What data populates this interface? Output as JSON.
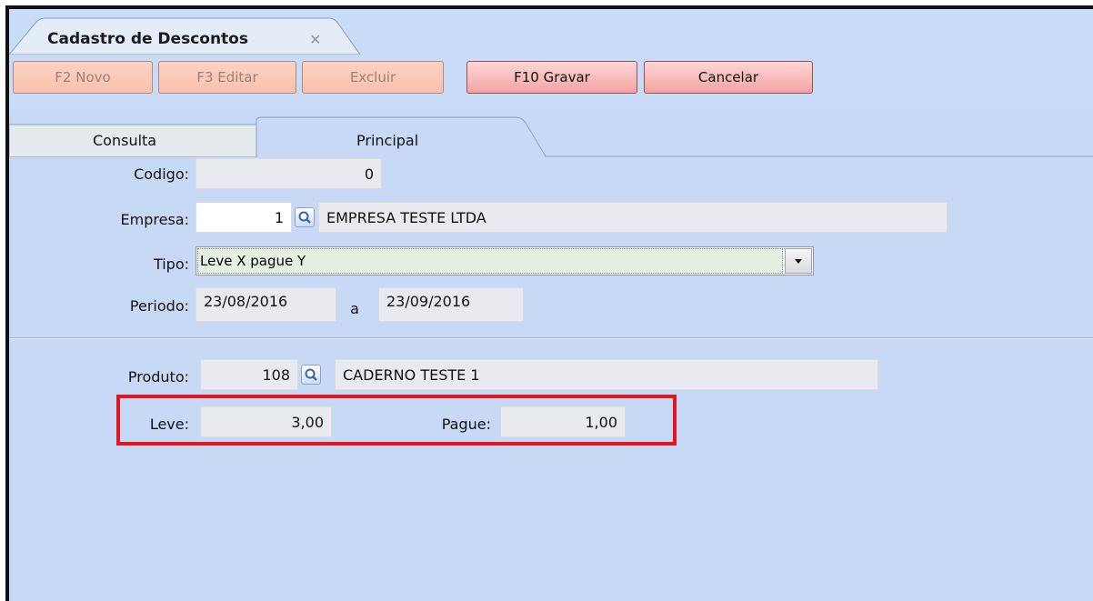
{
  "window": {
    "title": "Cadastro de Descontos",
    "close_glyph": "✕"
  },
  "toolbar": {
    "new_label": "F2 Novo",
    "edit_label": "F3 Editar",
    "delete_label": "Excluir",
    "save_label": "F10 Gravar",
    "cancel_label": "Cancelar"
  },
  "tabs": {
    "consulta": "Consulta",
    "principal": "Principal"
  },
  "form": {
    "codigo_label": "Codigo:",
    "codigo_value": "0",
    "empresa_label": "Empresa:",
    "empresa_id": "1",
    "empresa_name": "EMPRESA TESTE LTDA",
    "tipo_label": "Tipo:",
    "tipo_value": "Leve X pague Y",
    "periodo_label": "Periodo:",
    "periodo_start": "23/08/2016",
    "periodo_sep": "a",
    "periodo_end": "23/09/2016",
    "produto_label": "Produto:",
    "produto_id": "108",
    "produto_name": "CADERNO TESTE 1",
    "leve_label": "Leve:",
    "leve_value": "3,00",
    "pague_label": "Pague:",
    "pague_value": "1,00"
  },
  "icons": {
    "lookup": "magnifier-icon",
    "dropdown": "chevron-down-icon",
    "close": "close-icon"
  },
  "colors": {
    "background": "#c8d9f5",
    "button_disabled": "#f8c1ad",
    "button_active": "#f2a3a3",
    "highlight": "#e5151f"
  }
}
